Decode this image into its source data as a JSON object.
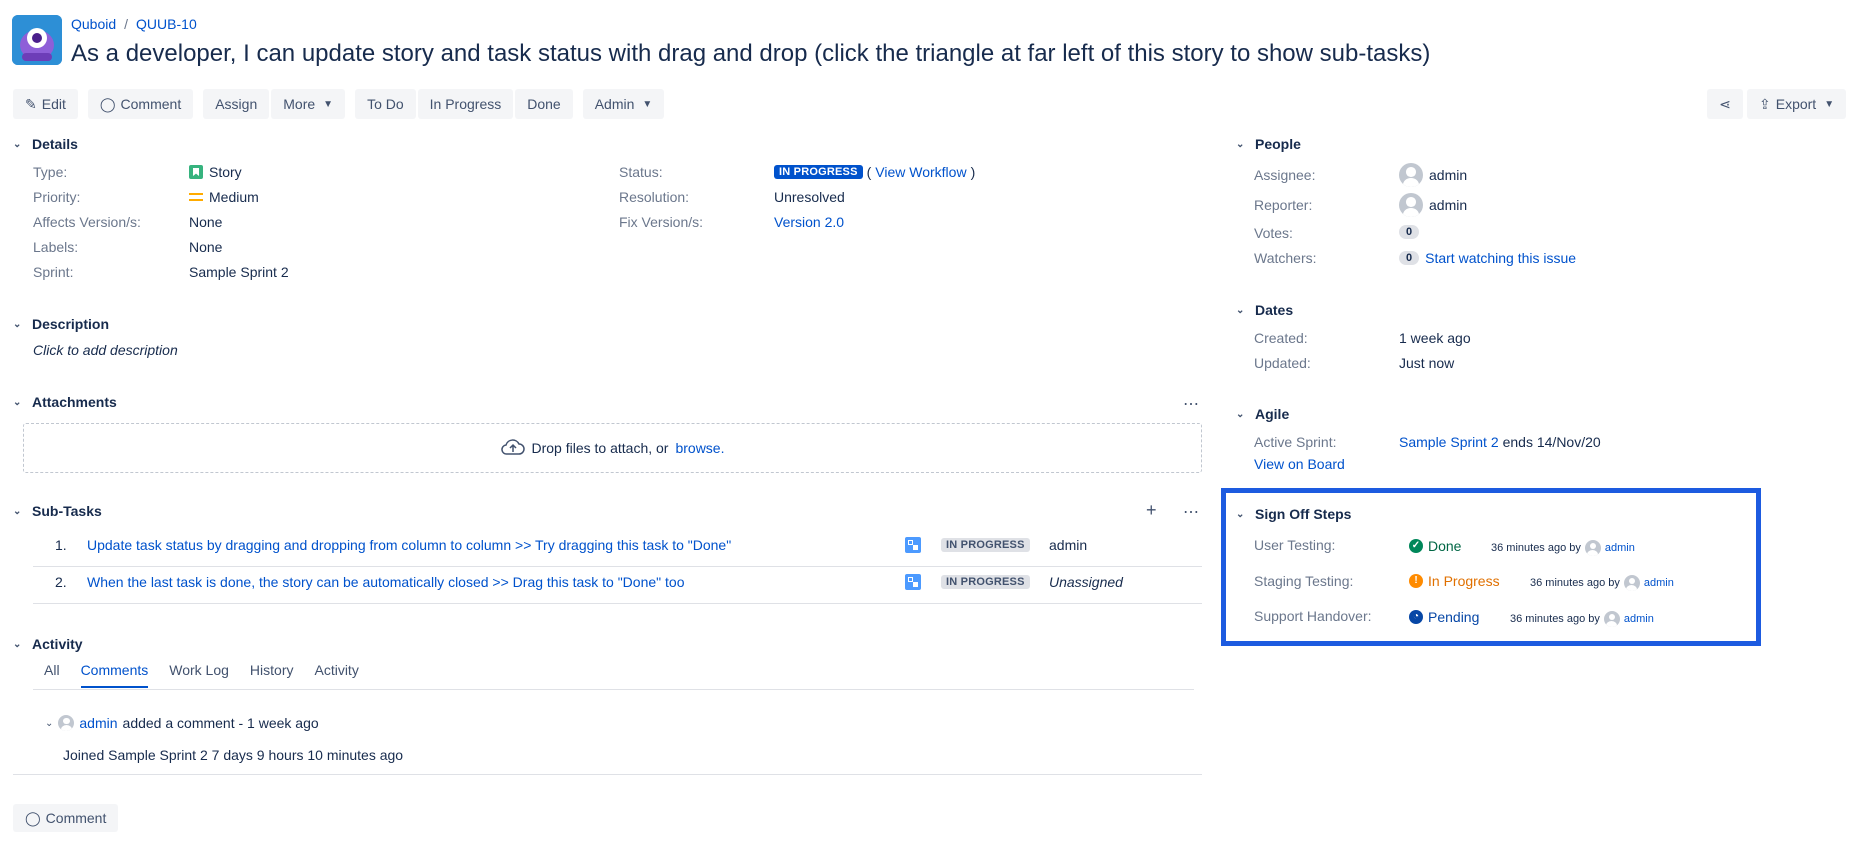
{
  "breadcrumb": {
    "project": "Quboid",
    "issue_key": "QUUB-10"
  },
  "summary": "As a developer, I can update story and task status with drag and drop (click the triangle at far left of this story to show sub-tasks)",
  "toolbar": {
    "edit": "Edit",
    "comment": "Comment",
    "assign": "Assign",
    "more": "More",
    "todo": "To Do",
    "in_progress": "In Progress",
    "done": "Done",
    "admin": "Admin",
    "export": "Export"
  },
  "details": {
    "heading": "Details",
    "type_label": "Type:",
    "type_value": "Story",
    "priority_label": "Priority:",
    "priority_value": "Medium",
    "affects_label": "Affects Version/s:",
    "affects_value": "None",
    "labels_label": "Labels:",
    "labels_value": "None",
    "sprint_label": "Sprint:",
    "sprint_value": "Sample Sprint 2",
    "status_label": "Status:",
    "status_value": "IN PROGRESS",
    "view_workflow": "View Workflow",
    "resolution_label": "Resolution:",
    "resolution_value": "Unresolved",
    "fix_label": "Fix Version/s:",
    "fix_value": "Version 2.0"
  },
  "description": {
    "heading": "Description",
    "placeholder": "Click to add description"
  },
  "attachments": {
    "heading": "Attachments",
    "drop_text": "Drop files to attach, or",
    "browse": "browse."
  },
  "subtasks": {
    "heading": "Sub-Tasks",
    "items": [
      {
        "num": "1.",
        "title": "Update task status by dragging and dropping from column to column >> Try dragging this task to \"Done\"",
        "status": "IN PROGRESS",
        "assignee": "admin"
      },
      {
        "num": "2.",
        "title": "When the last task is done, the story can be automatically closed >> Drag this task to \"Done\" too",
        "status": "IN PROGRESS",
        "assignee": "Unassigned"
      }
    ]
  },
  "activity": {
    "heading": "Activity",
    "tabs": [
      "All",
      "Comments",
      "Work Log",
      "History",
      "Activity"
    ],
    "active_tab": "Comments",
    "comment_author": "admin",
    "comment_meta": "added a comment - 1 week ago",
    "comment_body": "Joined Sample Sprint 2 7 days 9 hours 10 minutes ago",
    "comment_button": "Comment"
  },
  "people": {
    "heading": "People",
    "assignee_label": "Assignee:",
    "assignee_value": "admin",
    "reporter_label": "Reporter:",
    "reporter_value": "admin",
    "votes_label": "Votes:",
    "votes_value": "0",
    "watchers_label": "Watchers:",
    "watchers_value": "0",
    "watch_link": "Start watching this issue"
  },
  "dates": {
    "heading": "Dates",
    "created_label": "Created:",
    "created_value": "1 week ago",
    "updated_label": "Updated:",
    "updated_value": "Just now"
  },
  "agile": {
    "heading": "Agile",
    "sprint_label": "Active Sprint:",
    "sprint_link": "Sample Sprint 2",
    "sprint_ends": "ends 14/Nov/20",
    "board_link": "View on Board"
  },
  "signoff": {
    "heading": "Sign Off Steps",
    "steps": [
      {
        "label": "User Testing:",
        "status": "Done",
        "time": "36 minutes ago by",
        "user": "admin",
        "color": "#00875A"
      },
      {
        "label": "Staging Testing:",
        "status": "In Progress",
        "time": "36 minutes ago by",
        "user": "admin",
        "color": "#FF8B00"
      },
      {
        "label": "Support Handover:",
        "status": "Pending",
        "time": "36 minutes ago by",
        "user": "admin",
        "color": "#0747A6"
      }
    ]
  },
  "colors": {
    "link": "#0052CC",
    "highlight_border": "#1D5BE0",
    "lozenge_blue": "#0052CC"
  }
}
